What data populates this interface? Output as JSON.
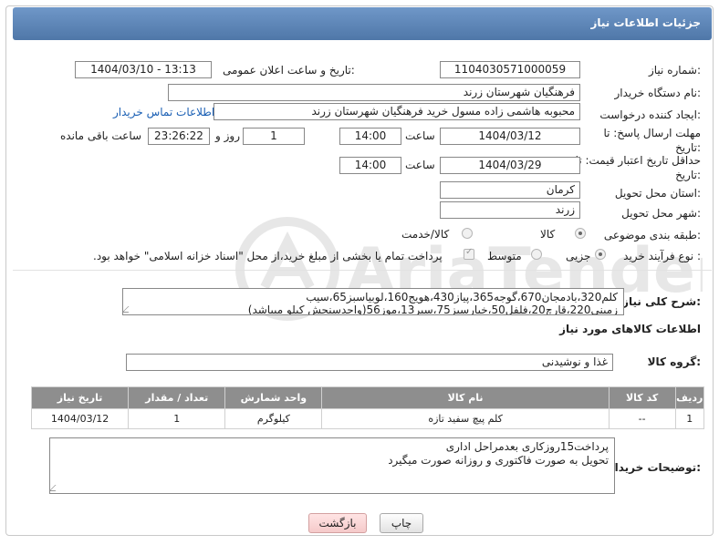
{
  "header": {
    "title": "جزئیات اطلاعات نیاز"
  },
  "fields": {
    "need_number_label": "شماره نیاز:",
    "need_number": "1104030571000059",
    "announce_label": "تاریخ و ساعت اعلان عمومی:",
    "announce_value": "1404/03/10 - 13:13",
    "buyer_org_label": "نام دستگاه خریدار:",
    "buyer_org": "فرهنگیان شهرستان زرند",
    "requester_label": "ایجاد کننده درخواست:",
    "requester": "محبوبه هاشمی زاده مسول خرید فرهنگیان شهرستان زرند",
    "contact_link": "اطلاعات تماس خریدار",
    "deadline_label": "مهلت ارسال پاسخ: تا تاریخ:",
    "deadline_date": "1404/03/12",
    "time_label": "ساعت",
    "deadline_time": "14:00",
    "days_value": "1",
    "days_label": "روز و",
    "remaining_time": "23:26:22",
    "remaining_label": "ساعت باقی مانده",
    "validity_label": "حداقل تاریخ اعتبار قیمت: تا تاریخ:",
    "validity_date": "1404/03/29",
    "validity_time": "14:00",
    "province_label": "استان محل تحویل:",
    "province": "کرمان",
    "city_label": "شهر محل تحویل:",
    "city": "زرند",
    "category_label": "طبقه بندی موضوعی:",
    "category_goods": "کالا",
    "category_service": "کالا/خدمت",
    "process_label": "نوع فرآیند خرید :",
    "process_small": "جزیی",
    "process_medium": "متوسط",
    "payment_note": "پرداخت تمام یا بخشی از مبلغ خرید،از محل \"اسناد خزانه اسلامی\" خواهد بود."
  },
  "description": {
    "label": "شرح کلی نیاز:",
    "line1": "کلم320،بادمجان670،گوجه365،پیاز430،هویج160،لوبیاسبز65،سیب",
    "line2": "زمینی220،قارچ20،فلفل50،خیارسبز75،سیر13،موز56(واحدسنجش کیلو میباشد)"
  },
  "goods_info": {
    "title": "اطلاعات کالاهای مورد نیاز",
    "group_label": "گروه کالا:",
    "group_value": "غذا و نوشیدنی"
  },
  "table": {
    "headers": [
      "ردیف",
      "کد کالا",
      "نام کالا",
      "واحد شمارش",
      "تعداد / مقدار",
      "تاریخ نیاز"
    ],
    "rows": [
      [
        "1",
        "--",
        "کلم پیچ سفید تازه",
        "کیلوگرم",
        "1",
        "1404/03/12"
      ]
    ]
  },
  "buyer_notes": {
    "label": "توضیحات خریدار:",
    "line1": "پرداخت15روزکاری بعدمراحل اداری",
    "line2": "تحویل به صورت فاکتوری و روزانه صورت میگیرد"
  },
  "buttons": {
    "print": "چاپ",
    "back": "بازگشت"
  },
  "watermark_text": "AriaTender.neT"
}
